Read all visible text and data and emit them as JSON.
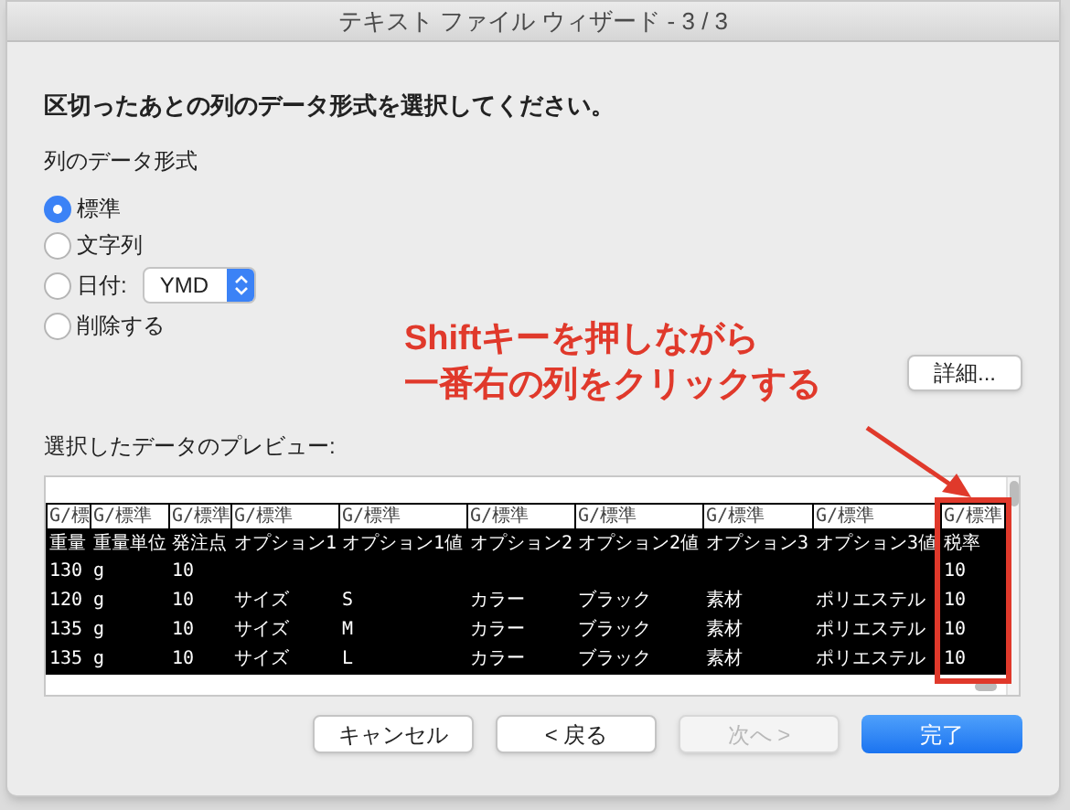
{
  "window": {
    "title": "テキスト ファイル ウィザード - 3 / 3"
  },
  "instruction": "区切ったあとの列のデータ形式を選択してください。",
  "format_group": {
    "label": "列のデータ形式",
    "options": [
      {
        "label": "標準",
        "selected": true,
        "kind": "plain"
      },
      {
        "label": "文字列",
        "selected": false,
        "kind": "plain"
      },
      {
        "label": "日付:",
        "selected": false,
        "kind": "date",
        "value": "YMD"
      },
      {
        "label": "削除する",
        "selected": false,
        "kind": "plain"
      }
    ]
  },
  "advanced_button": "詳細...",
  "annotation": {
    "lines": [
      "Shiftキーを押しながら",
      "一番右の列をクリックする"
    ]
  },
  "preview": {
    "label": "選択したデータのプレビュー:",
    "columns": [
      {
        "format": "G/標",
        "selected": true,
        "highlighted": false
      },
      {
        "format": "G/標準",
        "selected": true,
        "highlighted": false
      },
      {
        "format": "G/標準",
        "selected": true,
        "highlighted": false
      },
      {
        "format": "G/標準",
        "selected": true,
        "highlighted": false
      },
      {
        "format": "G/標準",
        "selected": true,
        "highlighted": false
      },
      {
        "format": "G/標準",
        "selected": true,
        "highlighted": false
      },
      {
        "format": "G/標準",
        "selected": true,
        "highlighted": false
      },
      {
        "format": "G/標準",
        "selected": true,
        "highlighted": false
      },
      {
        "format": "G/標準",
        "selected": true,
        "highlighted": false
      },
      {
        "format": "G/標準",
        "selected": true,
        "highlighted": true
      }
    ],
    "rows": [
      [
        "重量",
        "重量単位",
        "発注点",
        "オプション1",
        "オプション1値",
        "オプション2",
        "オプション2値",
        "オプション3",
        "オプション3値",
        "税率"
      ],
      [
        "130",
        "g",
        "10",
        null,
        null,
        null,
        null,
        null,
        null,
        "10"
      ],
      [
        "120",
        "g",
        "10",
        "サイズ",
        "S",
        "カラー",
        "ブラック",
        "素材",
        "ポリエステル",
        "10"
      ],
      [
        "135",
        "g",
        "10",
        "サイズ",
        "M",
        "カラー",
        "ブラック",
        "素材",
        "ポリエステル",
        "10"
      ],
      [
        "135",
        "g",
        "10",
        "サイズ",
        "L",
        "カラー",
        "ブラック",
        "素材",
        "ポリエステル",
        "10"
      ]
    ]
  },
  "buttons": [
    {
      "label": "キャンセル",
      "kind": "normal",
      "disabled": false
    },
    {
      "label": "< 戻る",
      "kind": "normal",
      "disabled": false
    },
    {
      "label": "次へ >",
      "kind": "normal",
      "disabled": true
    },
    {
      "label": "完了",
      "kind": "primary",
      "disabled": false
    }
  ]
}
